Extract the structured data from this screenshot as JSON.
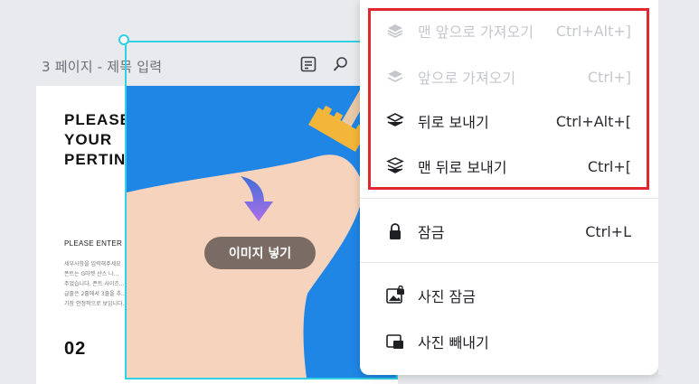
{
  "page": {
    "label": "3 페이지 - 제목 입력"
  },
  "document": {
    "title": "PLEASE\nYOUR\nPERTIN",
    "subtitle": "PLEASE ENTER",
    "body_lines": [
      "세부사항을 입력해주세요",
      "폰트는 G마켓 산스 나...",
      "주었습니다. 폰트 사이즈...",
      "글줄은 2줄에서 3줄을 추...",
      "가장 안정적으로 보입니다."
    ],
    "number": "02"
  },
  "frame": {
    "insert_label": "이미지 넣기"
  },
  "menu": {
    "items": [
      {
        "label": "맨 앞으로 가져오기",
        "shortcut": "Ctrl+Alt+]",
        "icon": "bring-to-front-icon",
        "disabled": true
      },
      {
        "label": "앞으로 가져오기",
        "shortcut": "Ctrl+]",
        "icon": "bring-forward-icon",
        "disabled": true
      },
      {
        "label": "뒤로 보내기",
        "shortcut": "Ctrl+Alt+[",
        "icon": "send-backward-icon",
        "disabled": false
      },
      {
        "label": "맨 뒤로 보내기",
        "shortcut": "Ctrl+[",
        "icon": "send-to-back-icon",
        "disabled": false
      },
      {
        "label": "잠금",
        "shortcut": "Ctrl+L",
        "icon": "lock-icon",
        "disabled": false
      },
      {
        "label": "사진 잠금",
        "shortcut": "",
        "icon": "photo-lock-icon",
        "disabled": false
      },
      {
        "label": "사진 빼내기",
        "shortcut": "",
        "icon": "detach-photo-icon",
        "disabled": false
      }
    ]
  },
  "colors": {
    "highlight": "#e0262e",
    "selection": "#2fd1e2",
    "photo_bg": "#1f86e6",
    "skin": "#f5d3bd"
  }
}
